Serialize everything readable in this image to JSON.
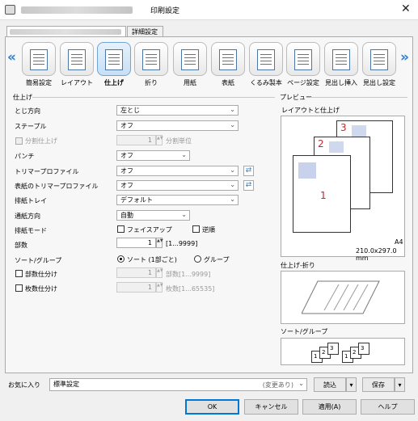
{
  "title_bar": {
    "title": "印刷設定",
    "close": "✕"
  },
  "tabs": {
    "active_label": "詳細設定"
  },
  "nav": {
    "prev": "«",
    "next": "»"
  },
  "toolbar_items": [
    {
      "label": "簡易設定"
    },
    {
      "label": "レイアウト"
    },
    {
      "label": "仕上げ"
    },
    {
      "label": "折り"
    },
    {
      "label": "用紙"
    },
    {
      "label": "表紙"
    },
    {
      "label": "くるみ製本"
    },
    {
      "label": "ページ設定"
    },
    {
      "label": "見出し挿入"
    },
    {
      "label": "見出し設定"
    }
  ],
  "finishing": {
    "section_title": "仕上げ",
    "binding_label": "とじ方向",
    "binding_value": "左とじ",
    "staple_label": "ステープル",
    "staple_value": "オフ",
    "split_label": "分割仕上げ",
    "split_value": "1",
    "split_unit": "分割単位",
    "punch_label": "パンチ",
    "punch_value": "オフ",
    "trimmer_label": "トリマープロファイル",
    "trimmer_value": "オフ",
    "cover_trimmer_label": "表紙のトリマープロファイル",
    "cover_trimmer_value": "オフ",
    "tray_label": "排紙トレイ",
    "tray_value": "デフォルト",
    "feed_dir_label": "通紙方向",
    "feed_dir_value": "自動",
    "output_mode_label": "排紙モード",
    "faceup_label": "フェイスアップ",
    "reverse_label": "逆順",
    "copies_label": "部数",
    "copies_value": "1",
    "copies_range": "[1...9999]",
    "sort_label": "ソート/グループ",
    "sort_option": "ソート (1部ごと)",
    "group_option": "グループ",
    "copy_split_label": "部数仕分け",
    "copy_split_value": "1",
    "copy_split_hint": "部数[1...9999]",
    "sheet_split_label": "枚数仕分け",
    "sheet_split_value": "1",
    "sheet_split_hint": "枚数[1...65535]"
  },
  "preview": {
    "section_title": "プレビュー",
    "layout_caption": "レイアウトと仕上げ",
    "page_numbers": [
      "1",
      "2",
      "3"
    ],
    "paper_size": "A4",
    "paper_dims": "210.0x297.0 mm",
    "fold_caption": "仕上げ-折り",
    "sort_caption": "ソート/グループ",
    "sort_digits": [
      "1",
      "2",
      "3"
    ]
  },
  "favorites": {
    "label": "お気に入り",
    "value": "標準設定",
    "status": "(変更あり)",
    "load_label": "読込",
    "save_label": "保存"
  },
  "buttons": {
    "ok": "OK",
    "cancel": "キャンセル",
    "apply": "適用(A)",
    "help": "ヘルプ"
  },
  "colors": {
    "accent": "#2d7fd3",
    "page_number": "#c0282a",
    "selected_icon": "#c7dff5"
  }
}
